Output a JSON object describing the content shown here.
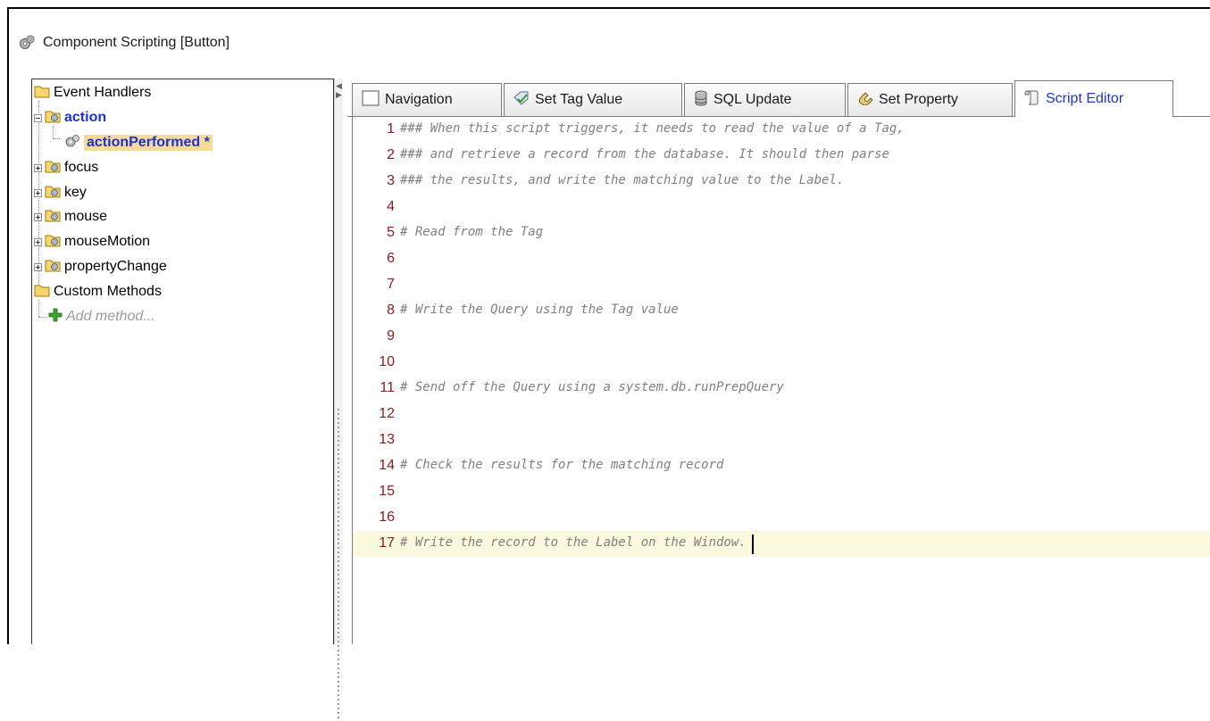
{
  "window": {
    "title": "Component Scripting [Button]"
  },
  "tree": {
    "items": [
      {
        "label": "Event Handlers",
        "kind": "folder"
      },
      {
        "label": "action",
        "kind": "event-folder",
        "expanded": true
      },
      {
        "label": "actionPerformed *",
        "kind": "script"
      },
      {
        "label": "focus",
        "kind": "event-folder"
      },
      {
        "label": "key",
        "kind": "event-folder"
      },
      {
        "label": "mouse",
        "kind": "event-folder"
      },
      {
        "label": "mouseMotion",
        "kind": "event-folder"
      },
      {
        "label": "propertyChange",
        "kind": "event-folder"
      },
      {
        "label": "Custom Methods",
        "kind": "folder"
      },
      {
        "label": "Add method...",
        "kind": "add"
      }
    ]
  },
  "tabs": [
    {
      "label": "Navigation",
      "icon": "navigation-icon"
    },
    {
      "label": "Set Tag Value",
      "icon": "tag-icon"
    },
    {
      "label": "SQL Update",
      "icon": "database-icon"
    },
    {
      "label": "Set Property",
      "icon": "property-icon"
    },
    {
      "label": "Script Editor",
      "icon": "script-icon",
      "active": true
    }
  ],
  "editor": {
    "lines": [
      {
        "num": "1",
        "text": "### When this script triggers, it needs to read the value of a Tag,"
      },
      {
        "num": "2",
        "text": "### and retrieve a record from the database. It should then parse"
      },
      {
        "num": "3",
        "text": "### the results, and write the matching value to the Label."
      },
      {
        "num": "4",
        "text": ""
      },
      {
        "num": "5",
        "text": "# Read from the Tag"
      },
      {
        "num": "6",
        "text": ""
      },
      {
        "num": "7",
        "text": ""
      },
      {
        "num": "8",
        "text": "# Write the Query using the Tag value"
      },
      {
        "num": "9",
        "text": ""
      },
      {
        "num": "10",
        "text": ""
      },
      {
        "num": "11",
        "text": "# Send off the Query using a system.db.runPrepQuery"
      },
      {
        "num": "12",
        "text": ""
      },
      {
        "num": "13",
        "text": ""
      },
      {
        "num": "14",
        "text": "# Check the results for the matching record"
      },
      {
        "num": "15",
        "text": ""
      },
      {
        "num": "16",
        "text": ""
      },
      {
        "num": "17",
        "text": "# Write the record to the Label on the Window."
      }
    ],
    "current_line": 17
  },
  "colors": {
    "selected_text": "#1a31d6",
    "selection_highlight": "#f7d99c",
    "line_number": "#8b1a1a",
    "comment": "#808080",
    "current_line_bg": "#fbf9dd"
  }
}
